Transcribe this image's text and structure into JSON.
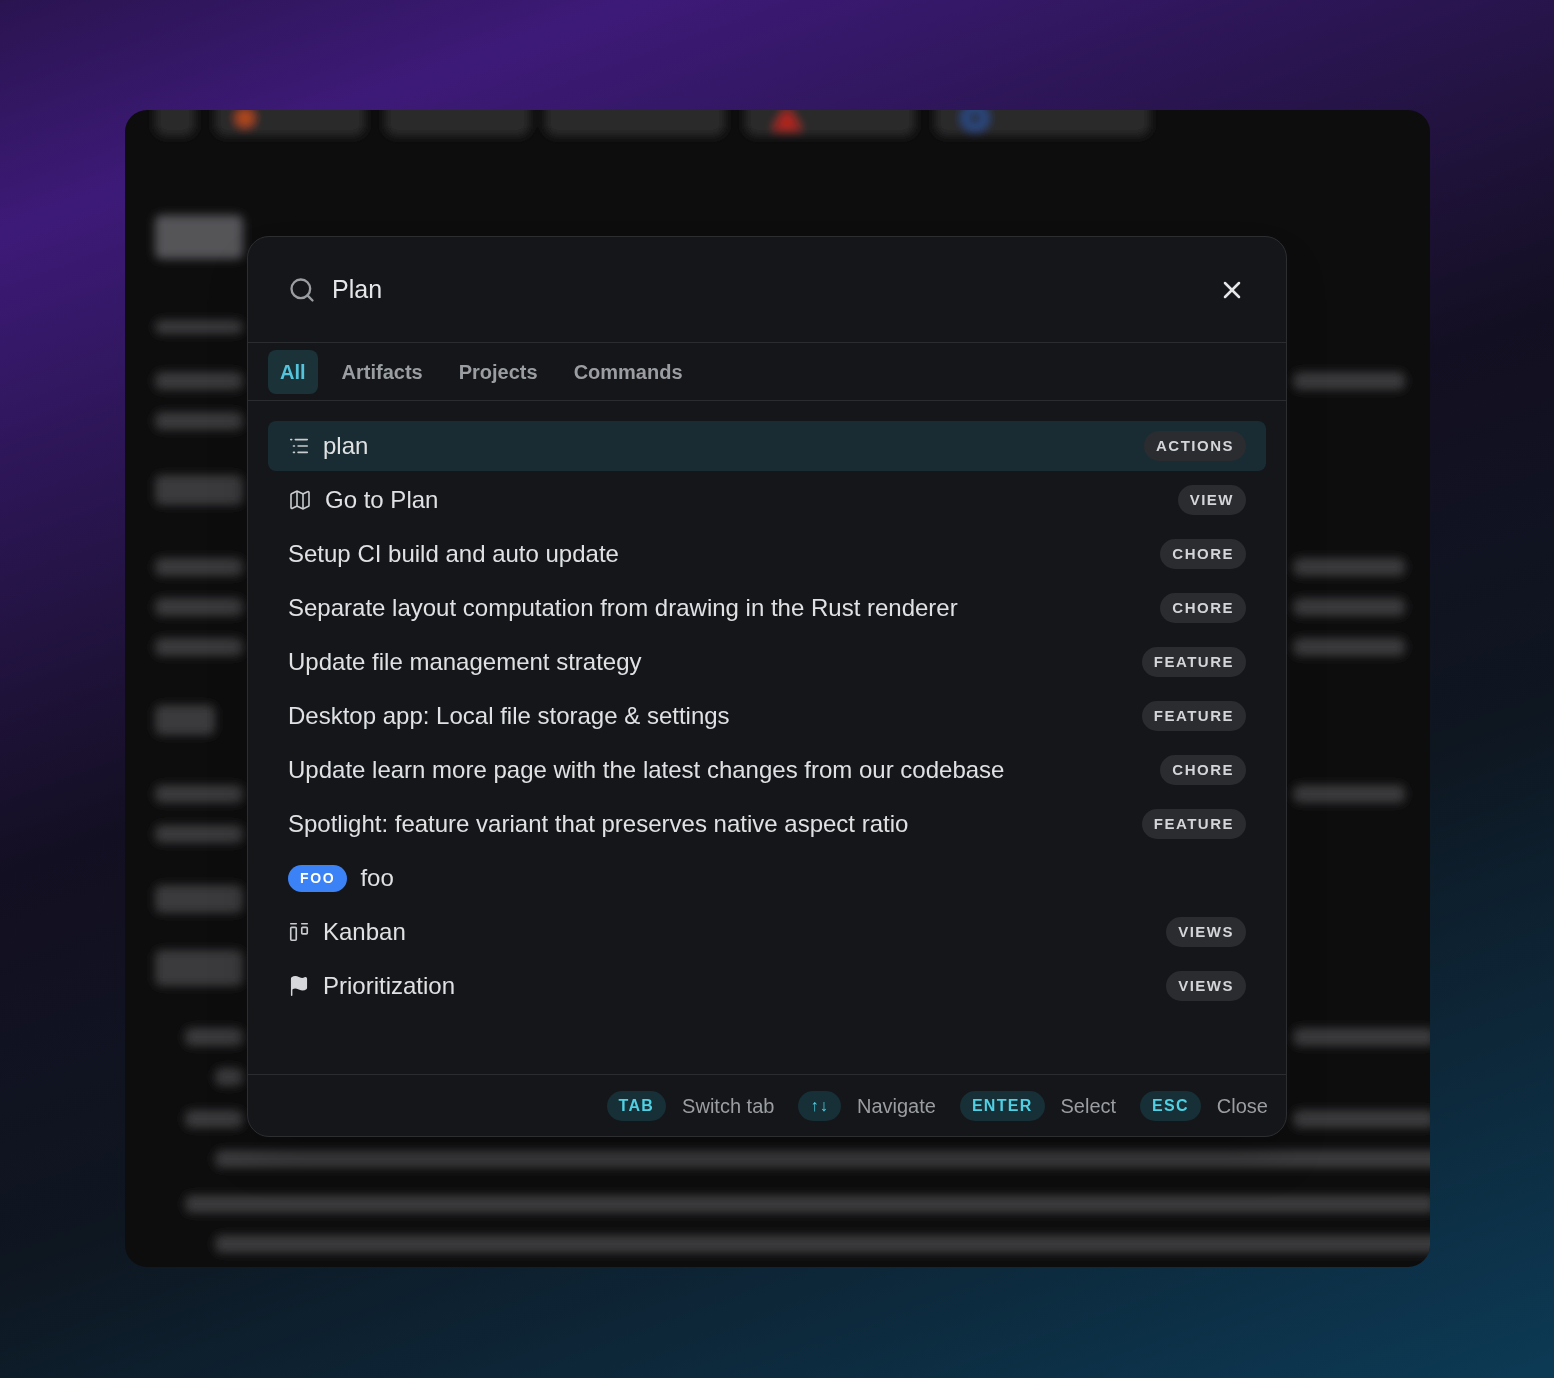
{
  "search": {
    "value": "Plan"
  },
  "tabs": [
    {
      "label": "All",
      "selected": true
    },
    {
      "label": "Artifacts",
      "selected": false
    },
    {
      "label": "Projects",
      "selected": false
    },
    {
      "label": "Commands",
      "selected": false
    }
  ],
  "results": [
    {
      "kind": "list",
      "label": "plan",
      "badge": "ACTIONS",
      "selected": true
    },
    {
      "kind": "map",
      "label": "Go to Plan",
      "badge": "VIEW",
      "selected": false
    },
    {
      "kind": "plain",
      "label": "Setup CI build and auto update",
      "badge": "CHORE",
      "selected": false
    },
    {
      "kind": "plain",
      "label": "Separate layout computation from drawing in the Rust renderer",
      "badge": "CHORE",
      "selected": false
    },
    {
      "kind": "plain",
      "label": "Update file management strategy",
      "badge": "FEATURE",
      "selected": false
    },
    {
      "kind": "plain",
      "label": "Desktop app: Local file storage & settings",
      "badge": "FEATURE",
      "selected": false
    },
    {
      "kind": "plain",
      "label": "Update learn more page with the latest changes from our codebase",
      "badge": "CHORE",
      "selected": false
    },
    {
      "kind": "plain",
      "label": "Spotlight: feature variant that preserves native aspect ratio",
      "badge": "FEATURE",
      "selected": false
    },
    {
      "kind": "tag",
      "tag": "FOO",
      "color": "#3b82f6",
      "label": "foo",
      "selected": false
    },
    {
      "kind": "board",
      "label": "Kanban",
      "badge": "VIEWS",
      "selected": false
    },
    {
      "kind": "flag",
      "label": "Prioritization",
      "badge": "VIEWS",
      "selected": false
    }
  ],
  "footer": [
    {
      "key": "TAB",
      "label": "Switch tab"
    },
    {
      "key": "↑↓",
      "label": "Navigate"
    },
    {
      "key": "ENTER",
      "label": "Select"
    },
    {
      "key": "ESC",
      "label": "Close"
    }
  ]
}
